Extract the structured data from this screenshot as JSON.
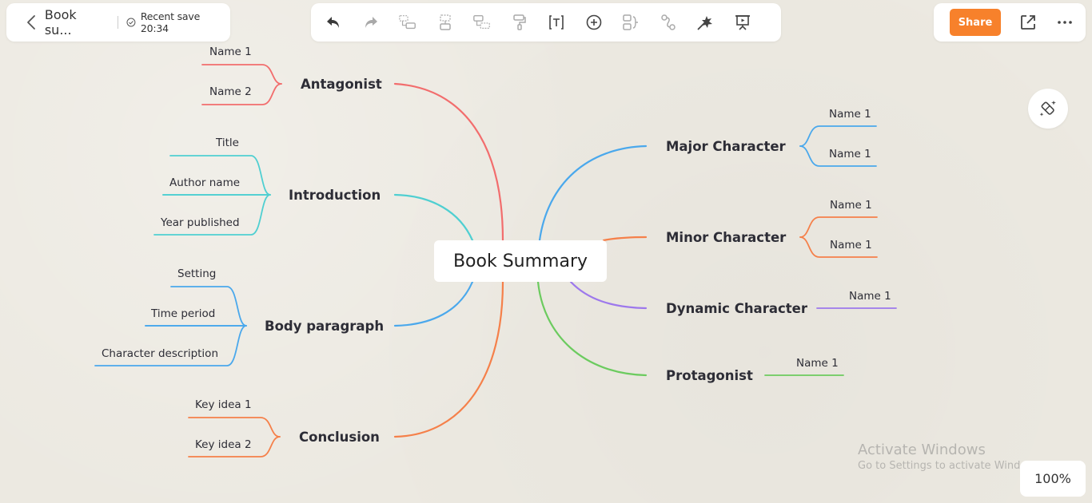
{
  "header": {
    "doc_title": "Book su...",
    "save_status": "Recent save 20:34"
  },
  "toolbar": {
    "items": [
      {
        "icon": "undo-icon",
        "label": "Undo"
      },
      {
        "icon": "redo-icon",
        "label": "Redo"
      },
      {
        "icon": "add-subtopic-icon",
        "label": "Subtopic"
      },
      {
        "icon": "add-sibling-topic-icon",
        "label": "Topic"
      },
      {
        "icon": "add-parent-topic-icon",
        "label": "Parent topic"
      },
      {
        "icon": "format-painter-icon",
        "label": "Format painter"
      },
      {
        "icon": "text-box-icon",
        "label": "Text"
      },
      {
        "icon": "insert-icon",
        "label": "Insert"
      },
      {
        "icon": "summary-icon",
        "label": "Summary"
      },
      {
        "icon": "relationship-icon",
        "label": "Relationship"
      },
      {
        "icon": "magic-wand-icon",
        "label": "Magic"
      },
      {
        "icon": "presentation-icon",
        "label": "Presentation"
      }
    ]
  },
  "actions": {
    "share_label": "Share",
    "zoom_level": "100%"
  },
  "watermark": {
    "line1": "Activate Windows",
    "line2": "Go to Settings to activate Windows."
  },
  "colors": {
    "share": "#f7812b",
    "antagonist": "#f26d6d",
    "introduction": "#4fcfd1",
    "body_paragraph": "#4aa8ec",
    "conclusion": "#f5804a",
    "major_character": "#4aa8ec",
    "minor_character": "#f5804a",
    "dynamic_character": "#9d78ec",
    "protagonist": "#6ccb5f"
  },
  "mindmap": {
    "central": "Book Summary",
    "left": [
      {
        "id": "antagonist",
        "label": "Antagonist",
        "children": [
          "Name 1",
          "Name 2"
        ]
      },
      {
        "id": "introduction",
        "label": "Introduction",
        "children": [
          "Title",
          "Author name",
          "Year published"
        ]
      },
      {
        "id": "body_paragraph",
        "label": "Body paragraph",
        "children": [
          "Setting",
          "Time period",
          "Character description"
        ]
      },
      {
        "id": "conclusion",
        "label": "Conclusion",
        "children": [
          "Key idea 1",
          "Key idea 2"
        ]
      }
    ],
    "right": [
      {
        "id": "major_character",
        "label": "Major Character",
        "children": [
          "Name 1",
          "Name 1"
        ]
      },
      {
        "id": "minor_character",
        "label": "Minor Character",
        "children": [
          "Name 1",
          "Name 1"
        ]
      },
      {
        "id": "dynamic_character",
        "label": "Dynamic Character",
        "children": [
          "Name 1"
        ]
      },
      {
        "id": "protagonist",
        "label": "Protagonist",
        "children": [
          "Name 1"
        ]
      }
    ]
  }
}
